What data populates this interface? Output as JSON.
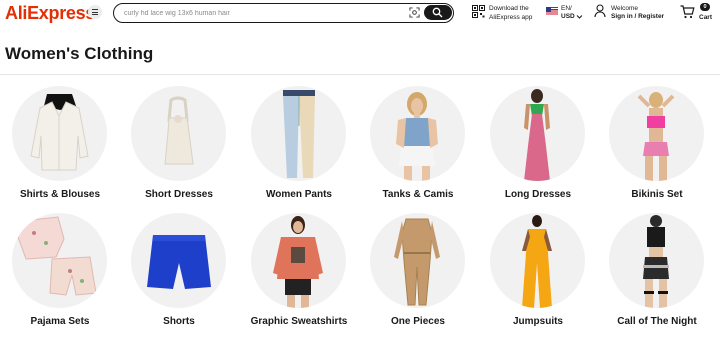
{
  "header": {
    "logo": "AliExpress",
    "search_placeholder": "curly hd lace wig 13x6 human hair",
    "app_line1": "Download the",
    "app_line2": "AliExpress app",
    "lang_line1": "EN/",
    "lang_line2": "USD",
    "account_line1": "Welcome",
    "account_line2": "Sign in / Register",
    "cart_count": "0",
    "cart_label": "Cart"
  },
  "page": {
    "title": "Women's Clothing"
  },
  "categories": [
    {
      "label": "Shirts & Blouses",
      "icon": "blouse-image"
    },
    {
      "label": "Short Dresses",
      "icon": "short-dress-image"
    },
    {
      "label": "Women Pants",
      "icon": "pants-image"
    },
    {
      "label": "Tanks & Camis",
      "icon": "tank-cami-image"
    },
    {
      "label": "Long Dresses",
      "icon": "long-dress-image"
    },
    {
      "label": "Bikinis Set",
      "icon": "bikini-image"
    },
    {
      "label": "Pajama Sets",
      "icon": "pajama-image"
    },
    {
      "label": "Shorts",
      "icon": "shorts-image"
    },
    {
      "label": "Graphic Sweatshirts",
      "icon": "sweatshirt-image"
    },
    {
      "label": "One Pieces",
      "icon": "jumpsuit-image"
    },
    {
      "label": "Jumpsuits",
      "icon": "jumpsuit-yellow-image"
    },
    {
      "label": "Call of The Night",
      "icon": "night-outfit-image"
    }
  ],
  "colors": {
    "brand": "#e62e04",
    "text": "#191919",
    "circle_bg": "#f1f1f1"
  }
}
